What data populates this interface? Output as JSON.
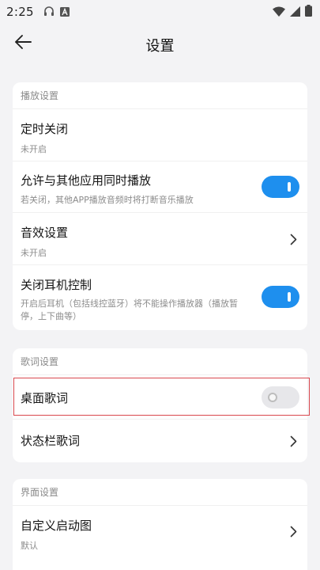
{
  "status_bar": {
    "time": "2:25"
  },
  "header": {
    "title": "设置"
  },
  "playback": {
    "header": "播放设置",
    "timer": {
      "title": "定时关闭",
      "subtitle": "未开启"
    },
    "mix": {
      "title": "允许与其他应用同时播放",
      "subtitle": "若关闭，其他APP播放音频时将打断音乐播放",
      "enabled": true
    },
    "sound": {
      "title": "音效设置",
      "subtitle": "未开启"
    },
    "earphone": {
      "title": "关闭耳机控制",
      "subtitle": "开启后耳机（包括线控蓝牙）将不能操作播放器（播放暂停，上下曲等）",
      "enabled": true
    }
  },
  "lyrics": {
    "header": "歌词设置",
    "desktop": {
      "title": "桌面歌词",
      "enabled": false
    },
    "statusbar": {
      "title": "状态栏歌词"
    }
  },
  "interface": {
    "header": "界面设置",
    "splash": {
      "title": "自定义启动图",
      "subtitle": "默认"
    }
  },
  "colors": {
    "accent": "#1e8fee",
    "highlight": "#d9484e",
    "background": "#f3f3f5"
  },
  "icons": [
    "headphones-icon",
    "font-a-icon",
    "wifi-icon",
    "signal-icon",
    "battery-icon",
    "back-arrow-icon",
    "chevron-right-icon"
  ]
}
